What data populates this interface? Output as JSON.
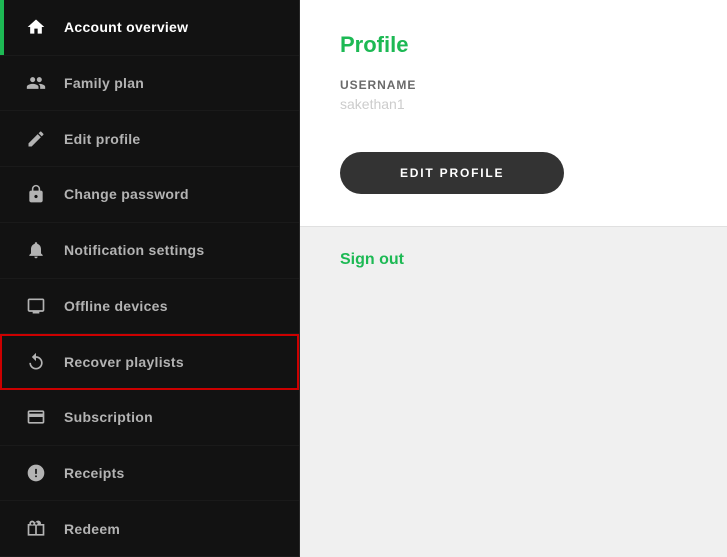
{
  "sidebar": {
    "items": [
      {
        "id": "account-overview",
        "label": "Account overview",
        "icon": "home-icon",
        "active": true,
        "highlighted": false
      },
      {
        "id": "family-plan",
        "label": "Family plan",
        "icon": "family-icon",
        "active": false,
        "highlighted": false
      },
      {
        "id": "edit-profile",
        "label": "Edit profile",
        "icon": "pencil-icon",
        "active": false,
        "highlighted": false
      },
      {
        "id": "change-password",
        "label": "Change password",
        "icon": "lock-icon",
        "active": false,
        "highlighted": false
      },
      {
        "id": "notification-settings",
        "label": "Notification settings",
        "icon": "bell-icon",
        "active": false,
        "highlighted": false
      },
      {
        "id": "offline-devices",
        "label": "Offline devices",
        "icon": "offline-icon",
        "active": false,
        "highlighted": false
      },
      {
        "id": "recover-playlists",
        "label": "Recover playlists",
        "icon": "recover-icon",
        "active": false,
        "highlighted": true
      },
      {
        "id": "subscription",
        "label": "Subscription",
        "icon": "subscription-icon",
        "active": false,
        "highlighted": false
      },
      {
        "id": "receipts",
        "label": "Receipts",
        "icon": "receipts-icon",
        "active": false,
        "highlighted": false
      },
      {
        "id": "redeem",
        "label": "Redeem",
        "icon": "redeem-icon",
        "active": false,
        "highlighted": false
      }
    ]
  },
  "main": {
    "profile": {
      "title": "Profile",
      "username_label": "Username",
      "username_value": "sakethan1",
      "edit_button_label": "EDIT PROFILE"
    },
    "bottom_title": "Sign out"
  }
}
